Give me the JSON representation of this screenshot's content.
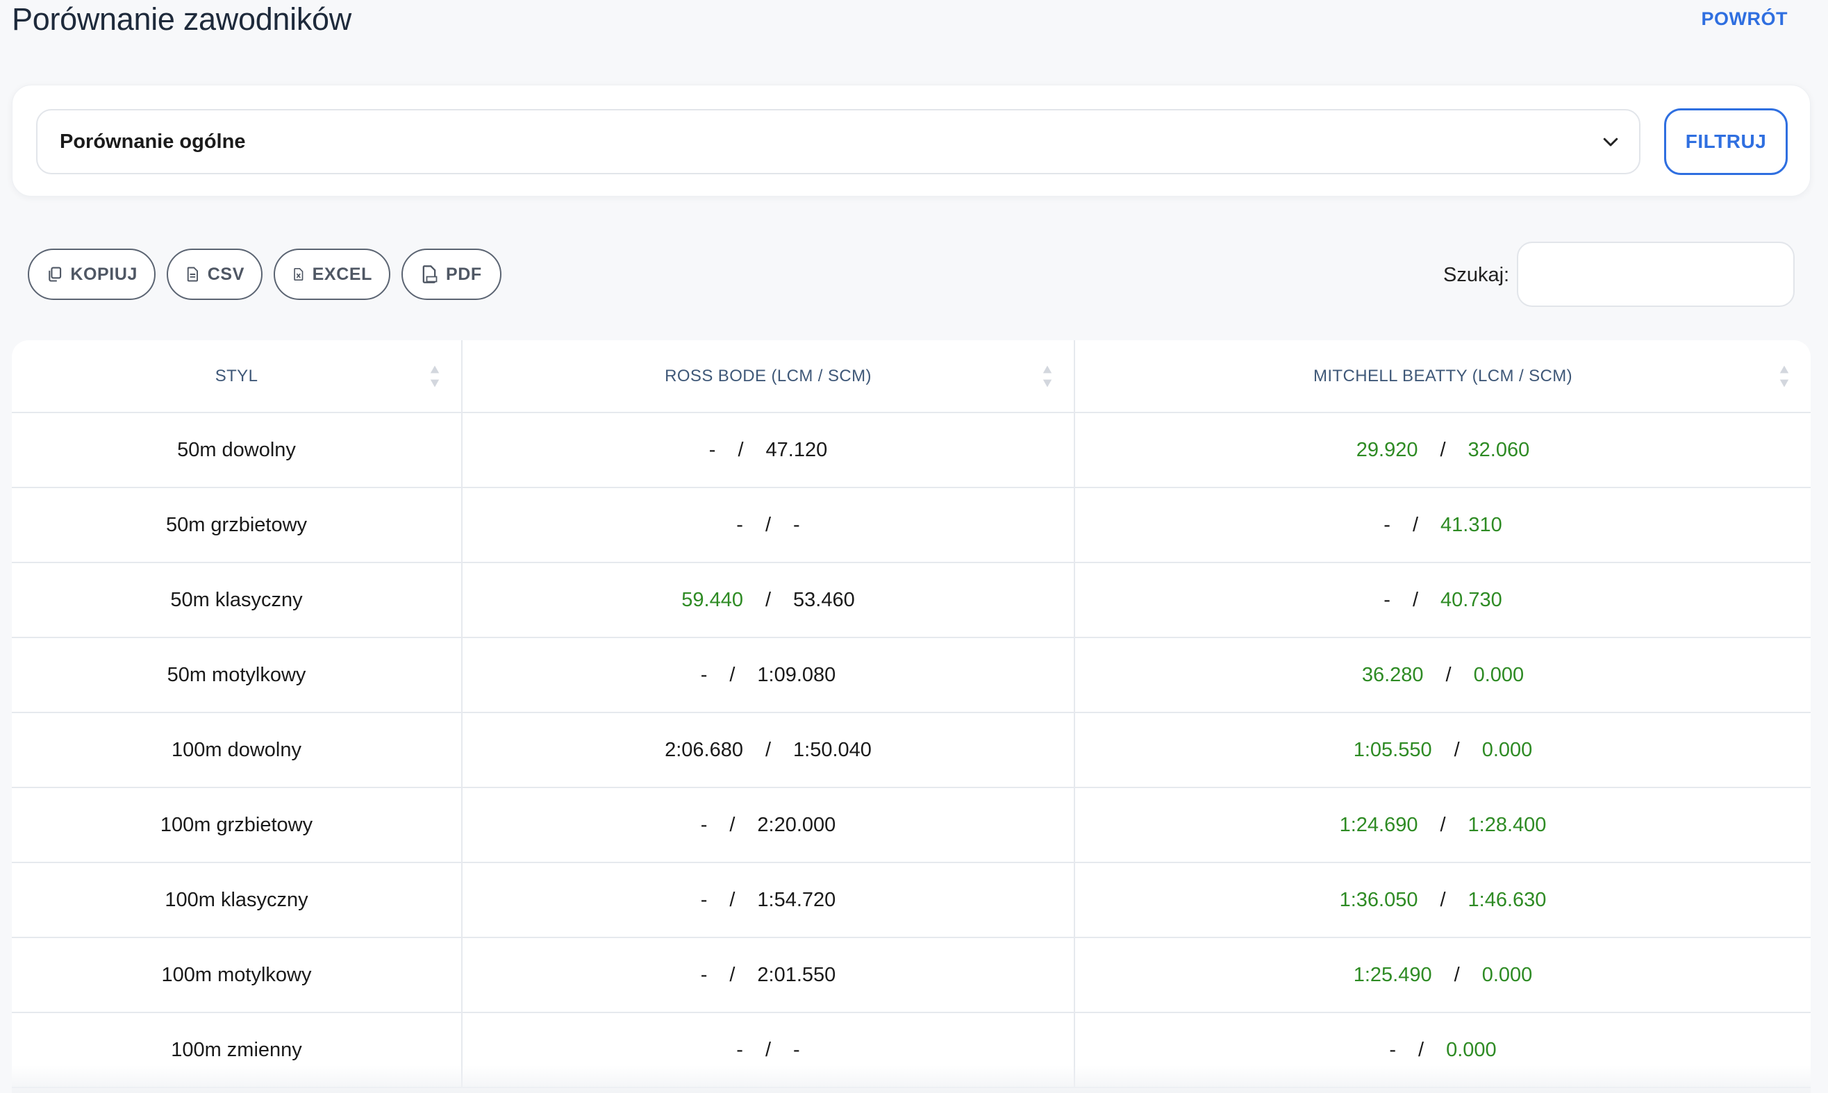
{
  "header": {
    "title": "Porównanie zawodników",
    "back_label": "POWRÓT"
  },
  "filter": {
    "selected": "Porównanie ogólne",
    "button_label": "FILTRUJ"
  },
  "export": {
    "copy_label": "KOPIUJ",
    "csv_label": "CSV",
    "excel_label": "EXCEL",
    "pdf_label": "PDF"
  },
  "search": {
    "label": "Szukaj:",
    "value": ""
  },
  "colors": {
    "accent": "#2f6fe0",
    "better_time": "#2e8b24",
    "header_text": "#3f5878"
  },
  "table": {
    "columns": [
      "STYL",
      "ROSS BODE (LCM / SCM)",
      "MITCHELL BEATTY (LCM / SCM)"
    ],
    "separator": "/",
    "rows": [
      {
        "style": "50m dowolny",
        "p1": [
          {
            "v": "-",
            "hl": false
          },
          {
            "v": "47.120",
            "hl": false
          }
        ],
        "p2": [
          {
            "v": "29.920",
            "hl": true
          },
          {
            "v": "32.060",
            "hl": true
          }
        ]
      },
      {
        "style": "50m grzbietowy",
        "p1": [
          {
            "v": "-",
            "hl": false
          },
          {
            "v": "-",
            "hl": false
          }
        ],
        "p2": [
          {
            "v": "-",
            "hl": false
          },
          {
            "v": "41.310",
            "hl": true
          }
        ]
      },
      {
        "style": "50m klasyczny",
        "p1": [
          {
            "v": "59.440",
            "hl": true
          },
          {
            "v": "53.460",
            "hl": false
          }
        ],
        "p2": [
          {
            "v": "-",
            "hl": false
          },
          {
            "v": "40.730",
            "hl": true
          }
        ]
      },
      {
        "style": "50m motylkowy",
        "p1": [
          {
            "v": "-",
            "hl": false
          },
          {
            "v": "1:09.080",
            "hl": false
          }
        ],
        "p2": [
          {
            "v": "36.280",
            "hl": true
          },
          {
            "v": "0.000",
            "hl": true
          }
        ]
      },
      {
        "style": "100m dowolny",
        "p1": [
          {
            "v": "2:06.680",
            "hl": false
          },
          {
            "v": "1:50.040",
            "hl": false
          }
        ],
        "p2": [
          {
            "v": "1:05.550",
            "hl": true
          },
          {
            "v": "0.000",
            "hl": true
          }
        ]
      },
      {
        "style": "100m grzbietowy",
        "p1": [
          {
            "v": "-",
            "hl": false
          },
          {
            "v": "2:20.000",
            "hl": false
          }
        ],
        "p2": [
          {
            "v": "1:24.690",
            "hl": true
          },
          {
            "v": "1:28.400",
            "hl": true
          }
        ]
      },
      {
        "style": "100m klasyczny",
        "p1": [
          {
            "v": "-",
            "hl": false
          },
          {
            "v": "1:54.720",
            "hl": false
          }
        ],
        "p2": [
          {
            "v": "1:36.050",
            "hl": true
          },
          {
            "v": "1:46.630",
            "hl": true
          }
        ]
      },
      {
        "style": "100m motylkowy",
        "p1": [
          {
            "v": "-",
            "hl": false
          },
          {
            "v": "2:01.550",
            "hl": false
          }
        ],
        "p2": [
          {
            "v": "1:25.490",
            "hl": true
          },
          {
            "v": "0.000",
            "hl": true
          }
        ]
      },
      {
        "style": "100m zmienny",
        "p1": [
          {
            "v": "-",
            "hl": false
          },
          {
            "v": "-",
            "hl": false
          }
        ],
        "p2": [
          {
            "v": "-",
            "hl": false
          },
          {
            "v": "0.000",
            "hl": true
          }
        ]
      }
    ]
  }
}
